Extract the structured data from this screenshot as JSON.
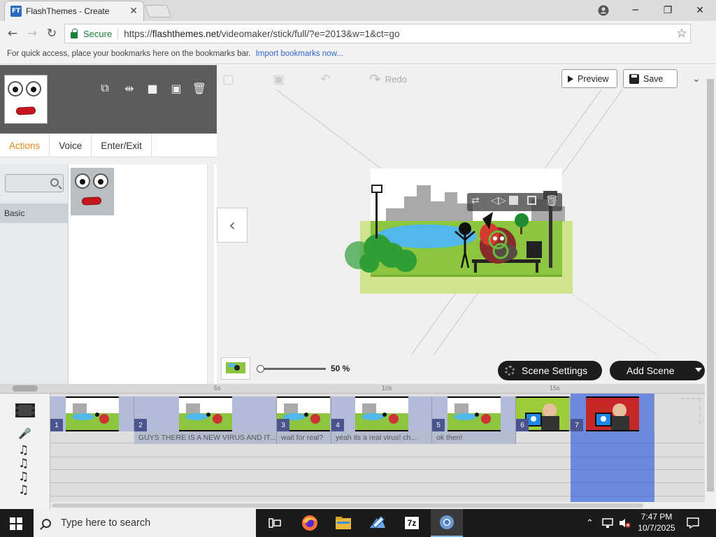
{
  "browser": {
    "tab_title": "FlashThemes - Create",
    "favicon_text": "FT",
    "secure_label": "Secure",
    "url_scheme": "https://",
    "url_host": "flashthemes.net",
    "url_path": "/videomaker/stick/full/?e=2013&w=1&ct=go",
    "bookmarks_text": "For quick access, place your bookmarks here on the bookmarks bar.",
    "bookmarks_link": "Import bookmarks now..."
  },
  "toolbar": {
    "redo_label": "Redo",
    "preview_label": "Preview",
    "save_label": "Save"
  },
  "left_panel": {
    "tabs": [
      {
        "label": "Actions",
        "active": true
      },
      {
        "label": "Voice",
        "active": false
      },
      {
        "label": "Enter/Exit",
        "active": false
      }
    ],
    "category": "Basic"
  },
  "stage_bottom": {
    "zoom_label": "50 %",
    "zoom_value": 0.5,
    "scene_settings_label": "Scene Settings",
    "add_scene_label": "Add Scene"
  },
  "timeline": {
    "ruler_ticks": [
      "5s",
      "10s",
      "15s"
    ],
    "scenes": [
      {
        "number": "1",
        "thumb": "park"
      },
      {
        "number": "2",
        "thumb": "park"
      },
      {
        "number": "3",
        "thumb": "park"
      },
      {
        "number": "4",
        "thumb": "park"
      },
      {
        "number": "5",
        "thumb": "park"
      },
      {
        "number": "6",
        "thumb": "meme"
      },
      {
        "number": "7",
        "thumb": "meme"
      }
    ],
    "dialogs": [
      "GUYS THERE IS A NEW VIRUS AND IT...",
      "wait for real?",
      "yeah its a real virus! ch...",
      "ok then!"
    ]
  },
  "taskbar": {
    "search_placeholder": "Type here to search",
    "time": "7:47 PM",
    "date": "10/7/2025",
    "apps": [
      "task-view-icon",
      "firefox-icon",
      "file-explorer-icon",
      "paint-icon",
      "7zip-icon",
      "chrome-icon"
    ],
    "sevenzip_label": "7z"
  },
  "colors": {
    "accent_tab": "#e28a18",
    "timeline_selection": "#466edc",
    "secure_green": "#188038"
  }
}
